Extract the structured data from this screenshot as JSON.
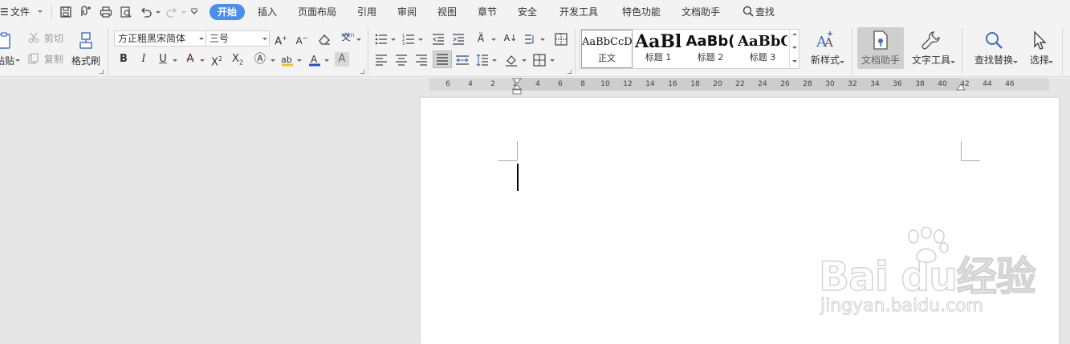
{
  "menubar": {
    "file_menu": "文件",
    "tabs": [
      "开始",
      "插入",
      "页面布局",
      "引用",
      "审阅",
      "视图",
      "章节",
      "安全",
      "开发工具",
      "特色功能",
      "文档助手"
    ],
    "search_label": "查找",
    "active_tab_color": "#4a8ff0"
  },
  "clipboard": {
    "paste_label": "粘贴",
    "cut_label": "剪切",
    "copy_label": "复制",
    "format_painter_label": "格式刷"
  },
  "font": {
    "font_name": "方正粗黑宋简体",
    "font_size": "三号",
    "bold_glyph": "B",
    "italic_glyph": "I",
    "underline_glyph": "U",
    "font_color": "#e02020",
    "highlight_color": "#f0c020",
    "text_color": "#1f4fd8"
  },
  "styles": {
    "items": [
      {
        "sample": "AaBbCcD",
        "name": "正文"
      },
      {
        "sample": "AaBl",
        "name": "标题 1"
      },
      {
        "sample": "AaBb(",
        "name": "标题 2"
      },
      {
        "sample": "AaBbC",
        "name": "标题 3"
      }
    ],
    "new_style_label": "新样式"
  },
  "tools": {
    "doc_helper_label": "文档助手",
    "text_tools_label": "文字工具",
    "find_replace_label": "查找替换",
    "select_label": "选择"
  },
  "ruler": {
    "ticks": [
      "6",
      "4",
      "2",
      "2",
      "4",
      "6",
      "8",
      "10",
      "12",
      "14",
      "16",
      "18",
      "20",
      "22",
      "24",
      "26",
      "28",
      "30",
      "32",
      "34",
      "36",
      "38",
      "40",
      "42",
      "44",
      "46"
    ]
  },
  "watermark": {
    "logo_text": "Bai  du经验",
    "url": "jingyan.baidu.com"
  }
}
